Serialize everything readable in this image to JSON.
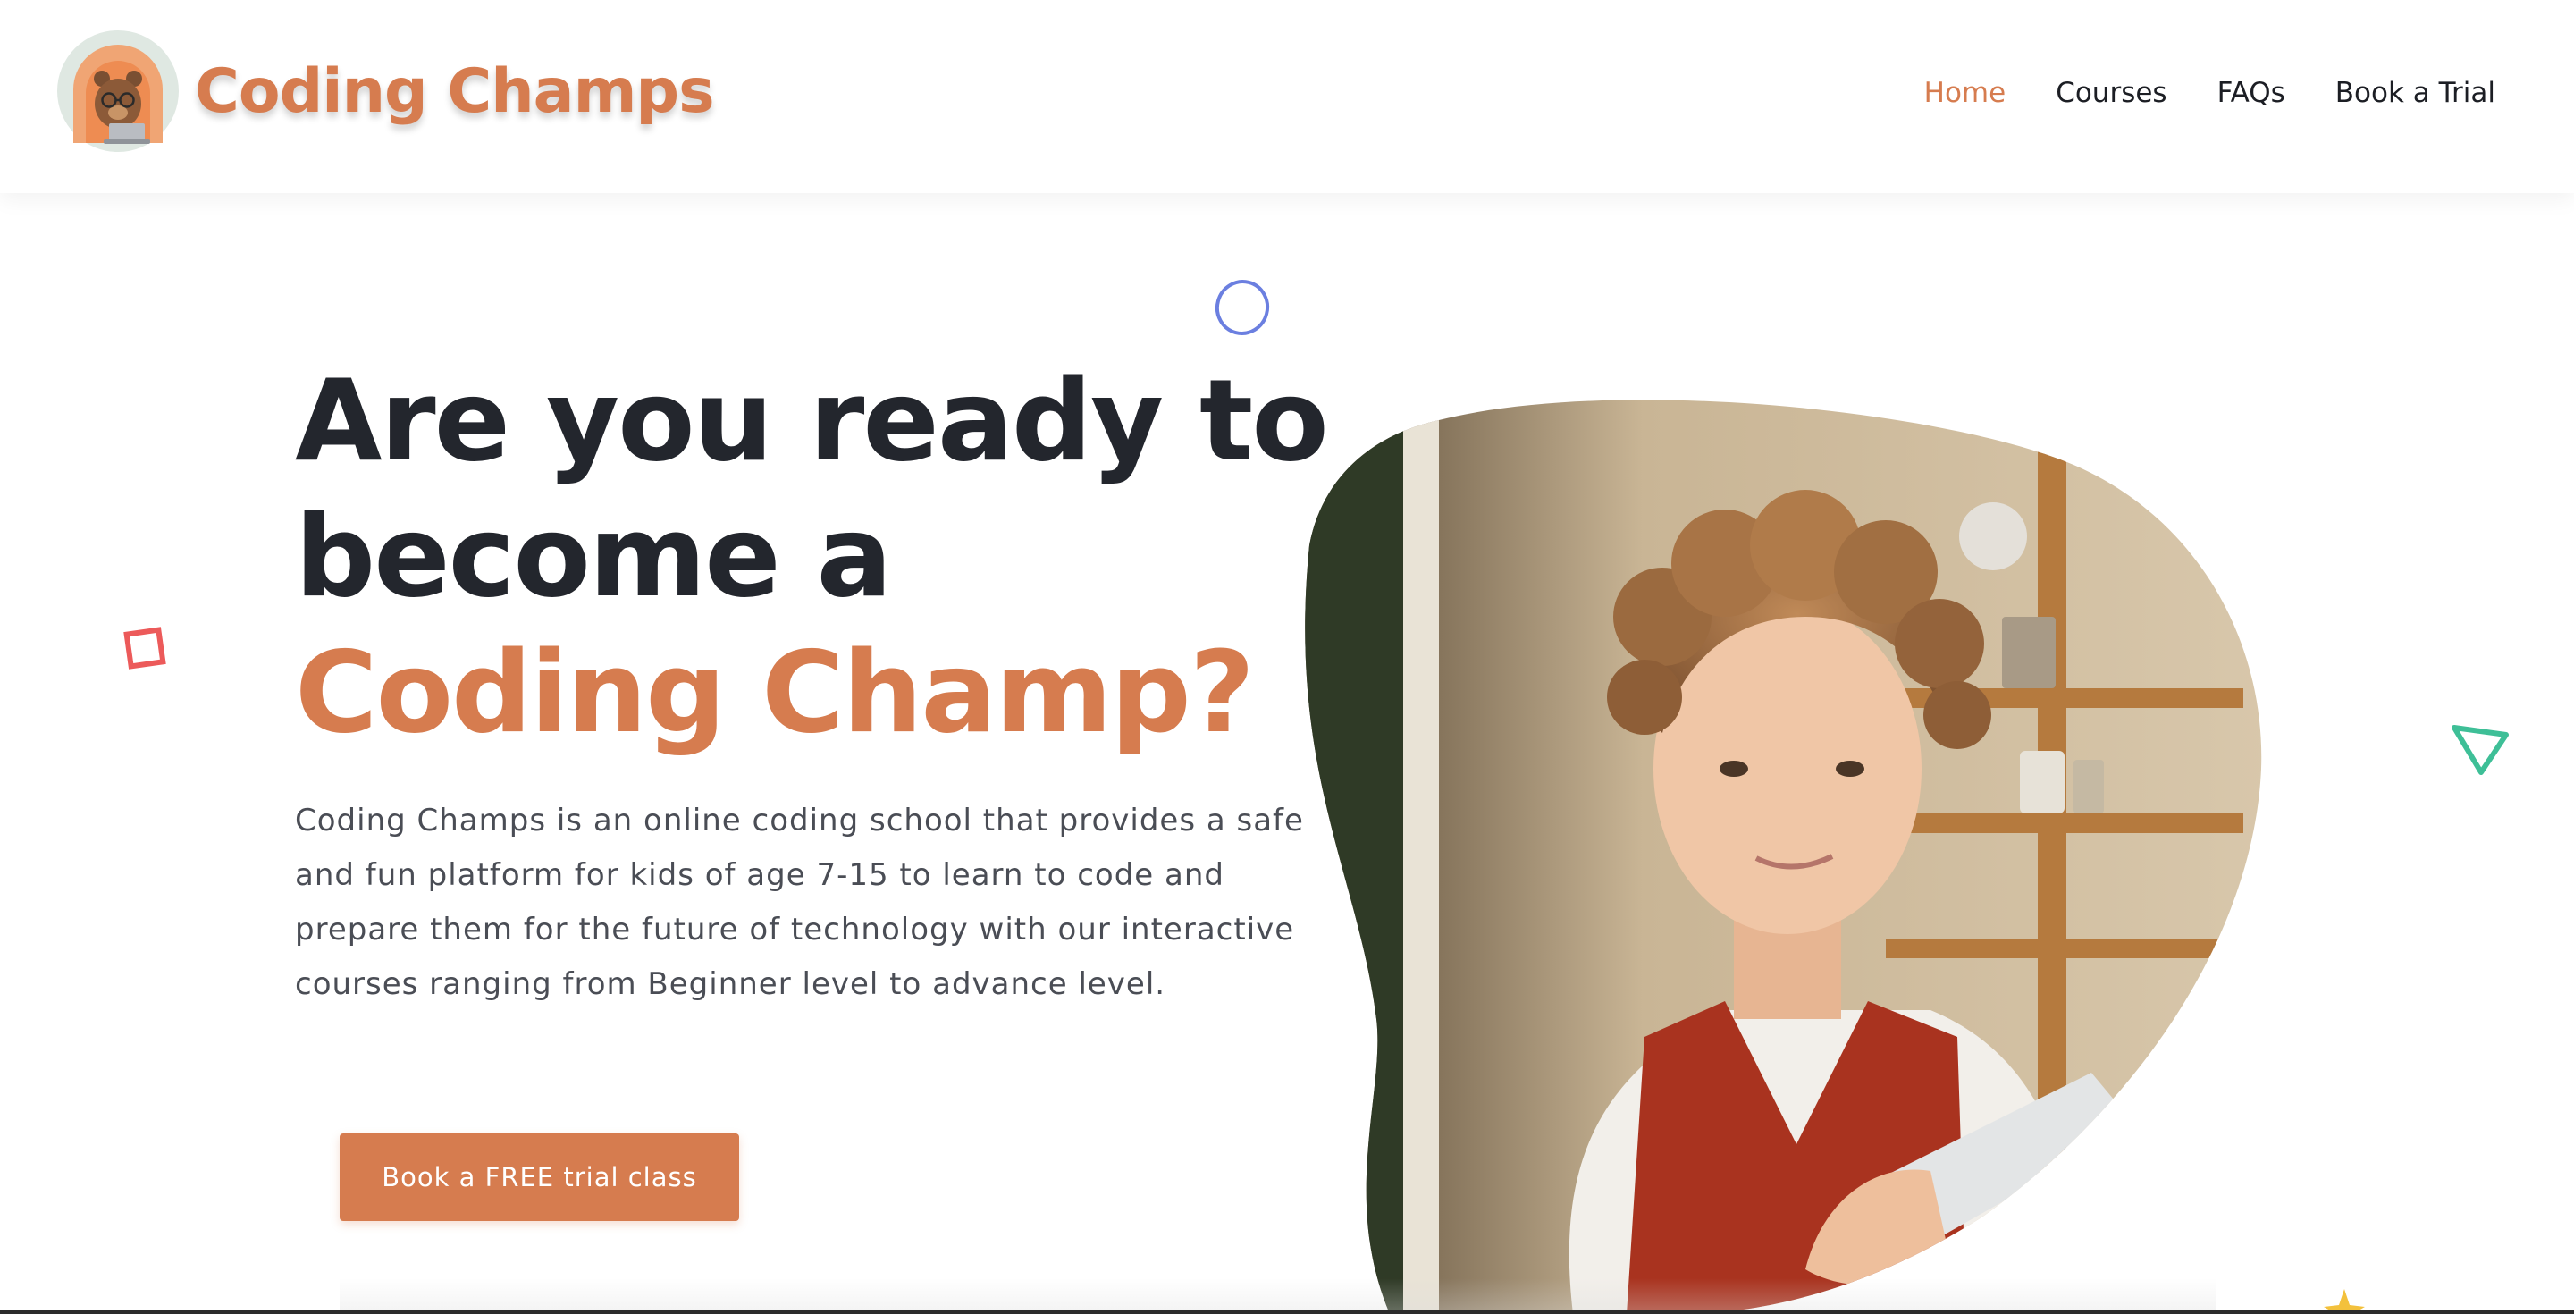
{
  "brand": {
    "name": "Coding Champs"
  },
  "nav": {
    "items": [
      {
        "label": "Home",
        "active": true
      },
      {
        "label": "Courses",
        "active": false
      },
      {
        "label": "FAQs",
        "active": false
      },
      {
        "label": "Book a Trial",
        "active": false
      }
    ]
  },
  "hero": {
    "title_line1": "Are you ready to",
    "title_line2": "become a",
    "title_accent": "Coding Champ?",
    "description": "Coding Champs is an online coding school that provides a safe and fun platform for kids of age 7-15 to learn to code and prepare them for the future of technology with our interactive courses ranging from Beginner level to advance level.",
    "cta_label": "Book a FREE trial class"
  },
  "colors": {
    "accent": "#d67c4f",
    "heading": "#23262d",
    "body_text": "#4a4d55",
    "deco_circle": "#6b7fe0",
    "deco_square": "#ec5a5a",
    "deco_triangle": "#3ebf97",
    "deco_star": "#f3c13c"
  },
  "icons": {
    "logo": "bear-with-glasses-and-laptop-icon",
    "decorations": [
      "circle-outline-icon",
      "square-outline-icon",
      "triangle-outline-icon",
      "star-icon"
    ]
  }
}
